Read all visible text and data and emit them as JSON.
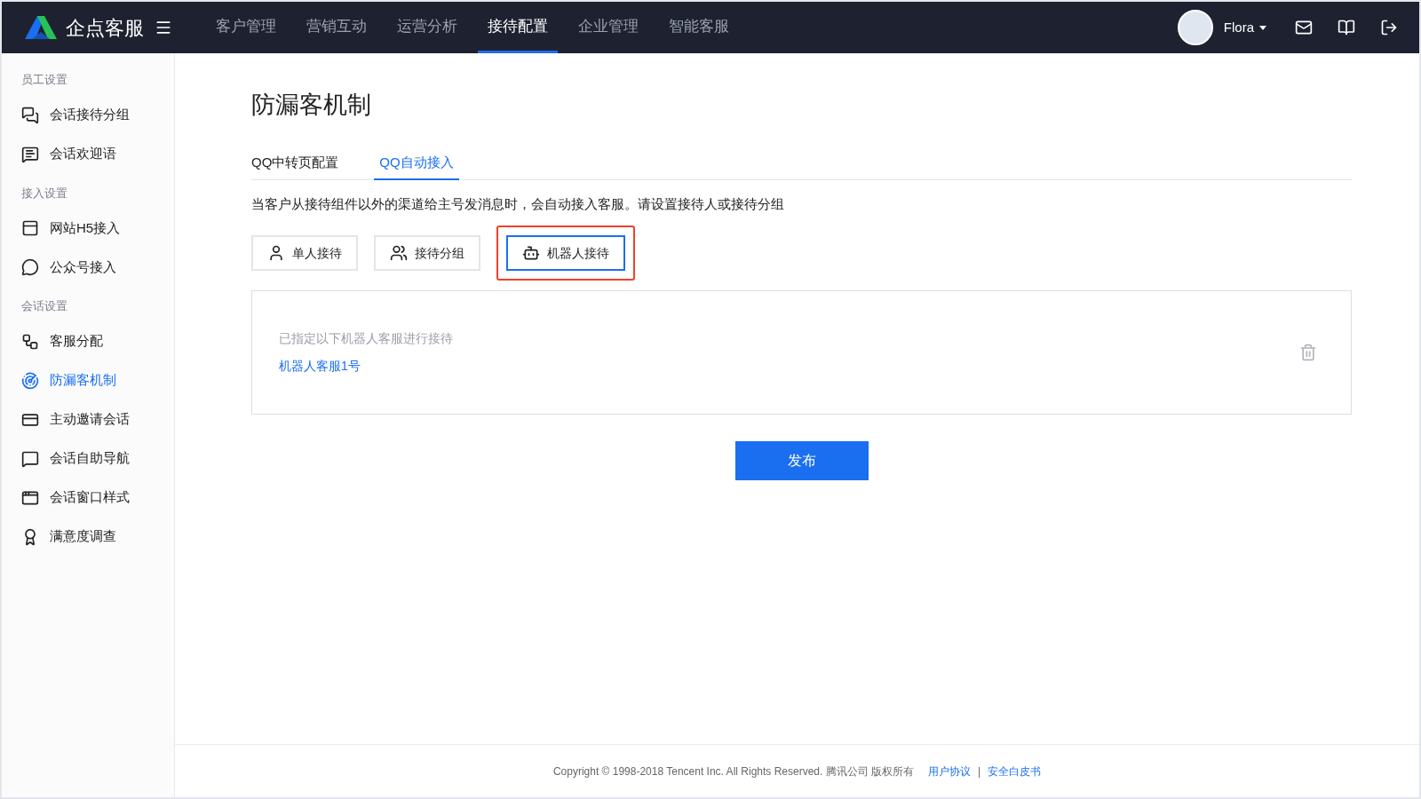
{
  "top_bar": {
    "brand": "企点客服",
    "nav": [
      {
        "label": "客户管理",
        "selected": false
      },
      {
        "label": "营销互动",
        "selected": false
      },
      {
        "label": "运营分析",
        "selected": false
      },
      {
        "label": "接待配置",
        "selected": true
      },
      {
        "label": "企业管理",
        "selected": false
      },
      {
        "label": "智能客服",
        "selected": false
      }
    ],
    "user": "Flora"
  },
  "sidebar": [
    {
      "heading": "员工设置",
      "items": [
        {
          "label": "会话接待分组",
          "selected": false
        },
        {
          "label": "会话欢迎语",
          "selected": false
        }
      ]
    },
    {
      "heading": "接入设置",
      "items": [
        {
          "label": "网站H5接入",
          "selected": false
        },
        {
          "label": "公众号接入",
          "selected": false
        }
      ]
    },
    {
      "heading": "会话设置",
      "items": [
        {
          "label": "客服分配",
          "selected": false
        },
        {
          "label": "防漏客机制",
          "selected": true
        },
        {
          "label": "主动邀请会话",
          "selected": false
        },
        {
          "label": "会话自助导航",
          "selected": false
        },
        {
          "label": "会话窗口样式",
          "selected": false
        },
        {
          "label": "满意度调查",
          "selected": false
        }
      ]
    }
  ],
  "page_title": "防漏客机制",
  "tabs": [
    {
      "label": "QQ中转页配置",
      "selected": false
    },
    {
      "label": "QQ自动接入",
      "selected": true
    }
  ],
  "description": "当客户从接待组件以外的渠道给主号发消息时，会自动接入客服。请设置接待人或接待分组",
  "options": [
    {
      "label": "单人接待",
      "selected": false,
      "highlighted": false
    },
    {
      "label": "接待分组",
      "selected": false,
      "highlighted": false
    },
    {
      "label": "机器人接待",
      "selected": true,
      "highlighted": true
    }
  ],
  "panel": {
    "hint": "已指定以下机器人客服进行接待",
    "assignee": "机器人客服1号"
  },
  "publish_button": "发布",
  "footer": {
    "copyright": "Copyright © 1998-2018 Tencent Inc. All Rights Reserved. 腾讯公司 版权所有",
    "links": [
      "用户协议",
      "安全白皮书"
    ],
    "separator": "|"
  }
}
